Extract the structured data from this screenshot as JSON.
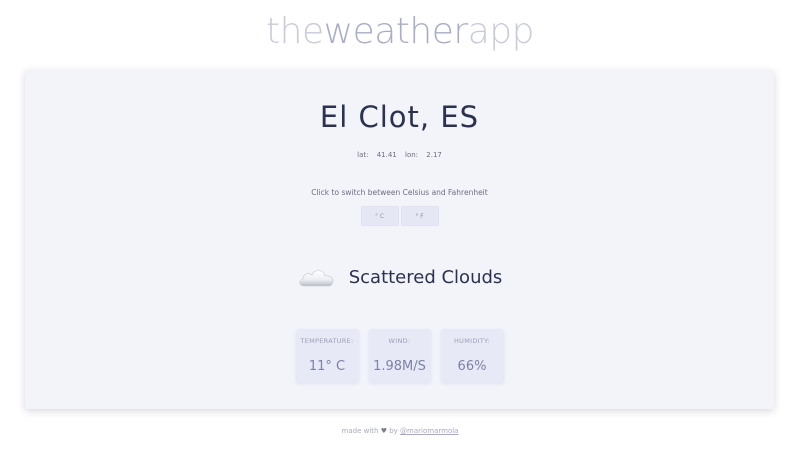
{
  "header": {
    "title_part1": "the",
    "title_part2": "weather",
    "title_part3": "app"
  },
  "location": {
    "city": "El Clot, ES",
    "lat_label": "lat:",
    "lat": "41.41",
    "lon_label": "lon:",
    "lon": "2.17"
  },
  "units": {
    "hint": "Click to switch between Celsius and Fahrenheit",
    "celsius_label": "° C",
    "fahrenheit_label": "° F"
  },
  "condition": {
    "icon": "cloud-icon",
    "text": "Scattered Clouds"
  },
  "stats": [
    {
      "label": "TEMPERATURE:",
      "value": "11° C"
    },
    {
      "label": "WIND:",
      "value": "1.98M/S"
    },
    {
      "label": "HUMIDITY:",
      "value": "66%"
    }
  ],
  "footer": {
    "made_with": "made with",
    "heart_icon": "heart-icon",
    "by": "by",
    "author": "@mariomarmola"
  },
  "colors": {
    "card_bg": "#f3f3fa",
    "stat_bg": "#e8e9f6",
    "title_light": "#c9cbdb",
    "title_bold": "#a9adc6",
    "city_text": "#2a3250"
  }
}
